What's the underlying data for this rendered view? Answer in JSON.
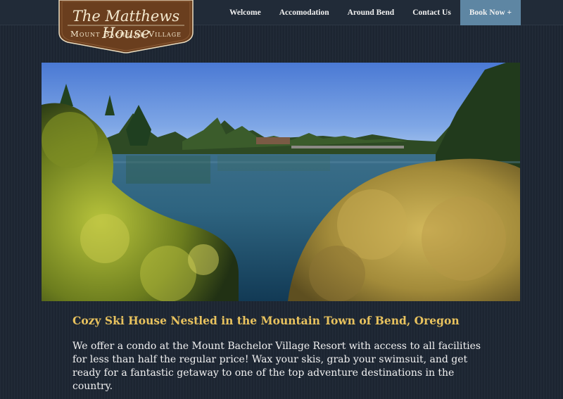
{
  "logo": {
    "title": "The Matthews House",
    "subtitle": "Mount Bachelor Village"
  },
  "nav": {
    "items": [
      "Welcome",
      "Accomodation",
      "Around Bend",
      "Contact Us"
    ],
    "book_now": "Book Now +"
  },
  "hero": {
    "image": "lake-trees-photo"
  },
  "main": {
    "heading": "Cozy Ski House Nestled in the Mountain Town of Bend, Oregon",
    "paragraph": "We offer a condo at the Mount Bachelor Village Resort with access to all facilities for less than half the regular price! Wax your skis, grab your swimsuit, and get ready for a fantastic getaway to one of the top adventure destinations in the country."
  },
  "colors": {
    "background": "#1d2633",
    "logo_brown": "#6b3f1f",
    "accent_gold": "#e8c25e",
    "book_button": "#5e86a3"
  }
}
